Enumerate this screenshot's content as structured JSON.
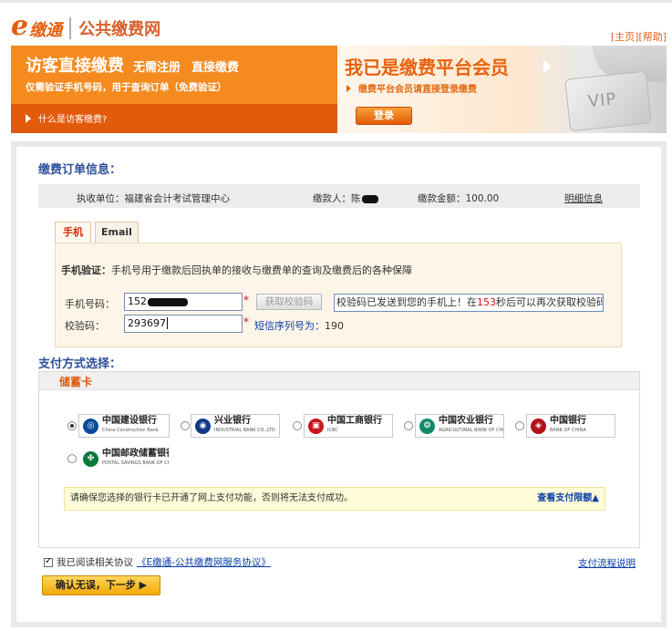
{
  "header": {
    "logo_e": "e",
    "logo_brand": "缴通",
    "logo_sub": "公共缴费网",
    "link_home": "[主页]",
    "link_help": "[帮助]"
  },
  "banner": {
    "guest_title": "访客直接缴费",
    "guest_tag1": "无需注册",
    "guest_tag2": "直接缴费",
    "guest_sub": "仅需验证手机号码，用于查询订单（免费验证）",
    "guest_link": "什么是访客缴费?",
    "member_title": "我已是缴费平台会员",
    "member_sub": "缴费平台会员请直接登录缴费",
    "login_label": "登录",
    "vip_label": "VIP"
  },
  "order": {
    "section_title": "缴费订单信息：",
    "unit": "执收单位：福建省会计考试管理中心",
    "payer": "缴款人：陈",
    "amount": "缴款金额：100.00",
    "detail_link": "明细信息"
  },
  "tabs": [
    {
      "label": "手机",
      "active": true
    },
    {
      "label": "Email",
      "active": false
    }
  ],
  "verify": {
    "heading_bold": "手机验证：",
    "heading_text": "手机号用于缴款后回执单的接收与缴费单的查询及缴费后的各种保障",
    "phone_label": "手机号码：",
    "phone_value": "152",
    "get_code_label": "获取校验码",
    "sent_prefix": "校验码已发送到您的手机上！在",
    "sent_seconds": "153",
    "sent_suffix": "秒后可以再次获取校验码",
    "code_label": "校验码：",
    "code_value": "293697",
    "sms_label": "短信序列号为：",
    "sms_value": "190"
  },
  "payment": {
    "section_title": "支付方式选择：",
    "card_type": "储蓄卡",
    "banks": [
      {
        "cn": "中国建设银行",
        "en": "China Construction Bank",
        "color": "#0b4a9c",
        "glyph": "◎",
        "selected": true
      },
      {
        "cn": "兴业银行",
        "en": "INDUSTRIAL BANK CO.,LTD.",
        "color": "#123a8a",
        "glyph": "◉",
        "selected": false
      },
      {
        "cn": "中国工商银行",
        "en": "ICBC",
        "color": "#c8161d",
        "glyph": "▣",
        "selected": false
      },
      {
        "cn": "中国农业银行",
        "en": "AGRICULTURAL BANK OF CHINA",
        "color": "#0e8a6b",
        "glyph": "❂",
        "selected": false
      },
      {
        "cn": "中国银行",
        "en": "BANK OF CHINA",
        "color": "#b3121b",
        "glyph": "◈",
        "selected": false
      },
      {
        "cn": "中国邮政储蓄银行",
        "en": "POSTAL SAVINGS BANK OF CHINA",
        "color": "#0a7a3c",
        "glyph": "✤",
        "selected": false
      }
    ],
    "notice": "请确保您选择的银行卡已开通了网上支付功能，否则将无法支付成功。",
    "limit_link": "查看支付限额▲"
  },
  "footer": {
    "agree_text": "我已阅读相关协议",
    "agreement_link": "《E缴通-公共缴费网服务协议》",
    "flow_link": "支付流程说明",
    "confirm_label": "确认无误，下一步 ▶"
  },
  "colors": {
    "brand_orange": "#e85c0b",
    "title_blue": "#2b4e9b",
    "link_blue": "#0a3fa8"
  }
}
